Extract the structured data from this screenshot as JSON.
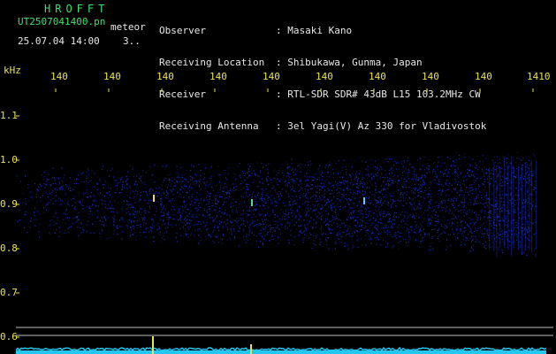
{
  "header": {
    "brand": "HROFFT",
    "filename": "UT2507041400.pn",
    "mode": "meteor",
    "date_time": "25.07.04 14:00",
    "count": "3..",
    "meta_labels": [
      "Observer",
      "Receiving Location",
      "Receiver",
      "Receiving Antenna"
    ],
    "meta_values": [
      ": Masaki Kano",
      ": Shibukawa, Gunma, Japan",
      ": RTL-SDR SDR# 43dB L15 103.2MHz CW",
      ": 3el Yagi(V) Az 330 for Vladivostok"
    ]
  },
  "plot": {
    "y_unit": "kHz",
    "x_ticks": [
      "140",
      "140",
      "140",
      "140",
      "140",
      "140",
      "140",
      "140",
      "140",
      "1410"
    ],
    "y_ticks": [
      "1.1",
      "1.0",
      "0.9",
      "0.8",
      "0.7",
      "0.6"
    ],
    "colors": {
      "signal": "#1c2fd6",
      "echo": "#e9e44a",
      "axis": "#e9e44a",
      "spectrum": "#23c7f2"
    }
  }
}
